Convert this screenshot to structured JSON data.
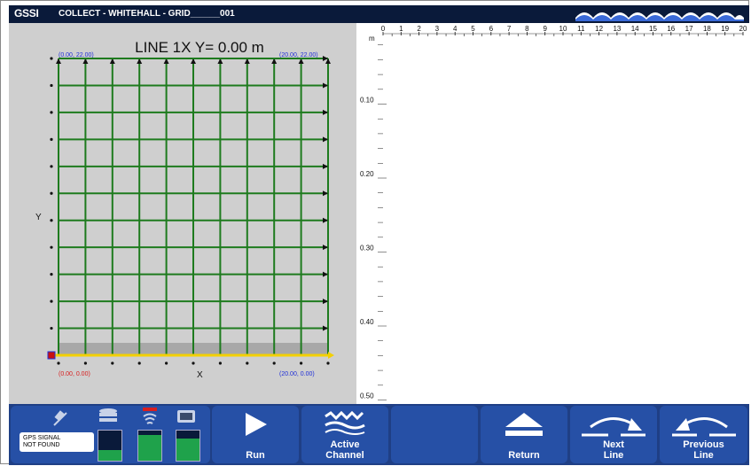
{
  "titlebar": {
    "logo": "GSSI",
    "title": "COLLECT - WHITEHALL - GRID______001"
  },
  "grid_panel": {
    "line_title": "LINE 1X  Y= 0.00 m",
    "corner_top_left": "(0.00, 22.00)",
    "corner_top_right": "(20.00, 22.00)",
    "corner_bottom_left": "(0.00, 0.00)",
    "corner_bottom_right": "(20.00, 0.00)",
    "axis_x": "X",
    "axis_y": "Y",
    "colors": {
      "grid_line": "#1e7b1e",
      "active_line": "#f3d000",
      "start_marker": "#c81010",
      "corner_blue": "#1f2fd8",
      "corner_red": "#d81f1f",
      "panel_bg": "#cfcfcf"
    }
  },
  "scan_panel": {
    "depth_unit": "m",
    "horizontal_ticks": [
      "0",
      "1",
      "2",
      "3",
      "4",
      "5",
      "6",
      "7",
      "8",
      "9",
      "10",
      "11",
      "12",
      "13",
      "14",
      "15",
      "16",
      "17",
      "18",
      "19",
      "20"
    ],
    "depth_labels": [
      "0.10",
      "0.20",
      "0.30",
      "0.40",
      "0.50"
    ]
  },
  "status": {
    "gps_text_line1": "GPS SIGNAL",
    "gps_text_line2": "NOT FOUND",
    "icons": [
      "satellite-icon",
      "storage-icon",
      "antenna-icon",
      "device-icon"
    ],
    "gauge_levels": [
      0.35,
      0.85,
      0.75
    ]
  },
  "buttons": {
    "run": "Run",
    "active_channel": "Active\nChannel",
    "blank": "",
    "return": "Return",
    "next_line": "Next\nLine",
    "previous_line": "Previous\nLine"
  }
}
